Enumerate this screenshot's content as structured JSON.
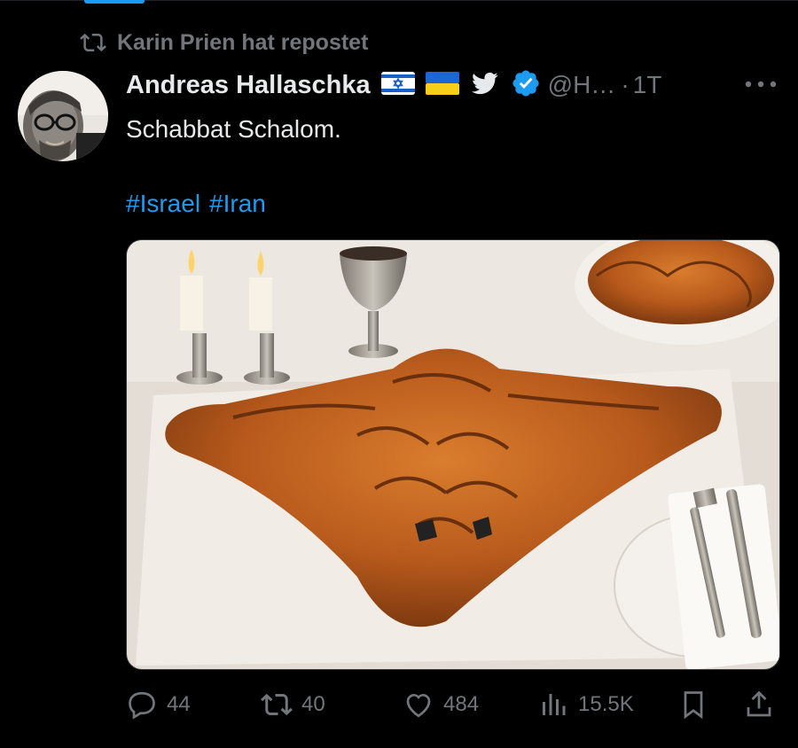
{
  "repost": {
    "label": "Karin Prien hat repostet",
    "icon": "repost-icon"
  },
  "author": {
    "display_name": "Andreas Hallaschka",
    "handle": "@H…",
    "separator": "·",
    "time": "1T",
    "emojis": [
      "israel-flag",
      "ukraine-flag",
      "twitter-bird",
      "verified-badge"
    ],
    "verified_color": "#1d9bf0"
  },
  "tweet": {
    "text": "Schabbat Schalom.",
    "hashtags": [
      "#Israel",
      "#Iran"
    ]
  },
  "media": {
    "alt": "Photo of challah bread shaped like a stealth bomber on a set table with candles, kiddush cup, plate and cutlery"
  },
  "actions": {
    "replies": "44",
    "reposts": "40",
    "likes": "484",
    "views": "15.5K"
  },
  "colors": {
    "accent": "#1d9bf0",
    "muted": "#71767b",
    "text": "#e7e9ea",
    "background": "#000000"
  }
}
